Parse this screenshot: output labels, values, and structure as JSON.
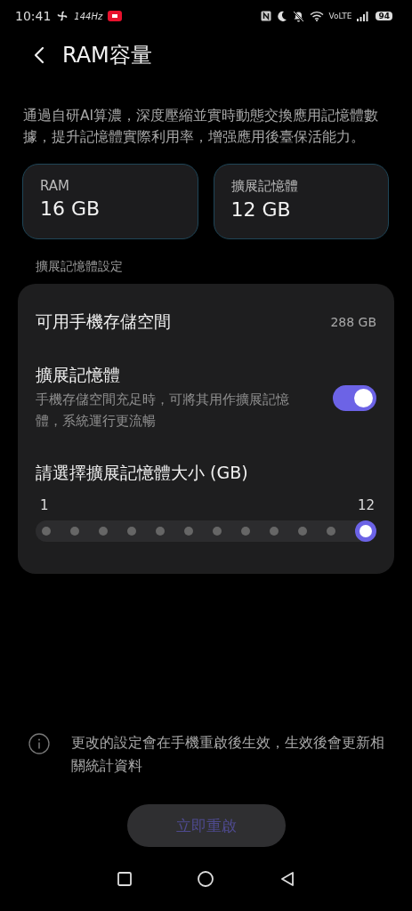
{
  "status_bar": {
    "time": "10:41",
    "refresh_rate": "144Hz",
    "network": "VoLTE",
    "battery": "94"
  },
  "header": {
    "title": "RAM容量"
  },
  "description": "通過自研AI算濃，深度壓縮並實時動態交換應用記憶體數據，提升記憶體實際利用率，增强應用後臺保活能力。",
  "memory_cards": [
    {
      "label": "RAM",
      "value": "16 GB"
    },
    {
      "label": "擴展記憶體",
      "value": "12 GB"
    }
  ],
  "section_title": "擴展記憶體設定",
  "settings": [
    {
      "kind": "info",
      "title": "可用手機存儲空間",
      "value": "288 GB"
    },
    {
      "kind": "toggle",
      "title": "擴展記憶體",
      "subtitle": "手機存儲空間充足時，可將其用作擴展記憶體，系統運行更流暢",
      "on": true
    },
    {
      "kind": "slider",
      "title": "請選擇擴展記憶體大小 (GB)",
      "min_label": "1",
      "max_label": "12",
      "level": 1
    }
  ],
  "notice": "更改的設定會在手機重啟後生效，生效後會更新相關統計資料",
  "restart_button": {
    "label": "立即重啟",
    "disabled": true
  }
}
